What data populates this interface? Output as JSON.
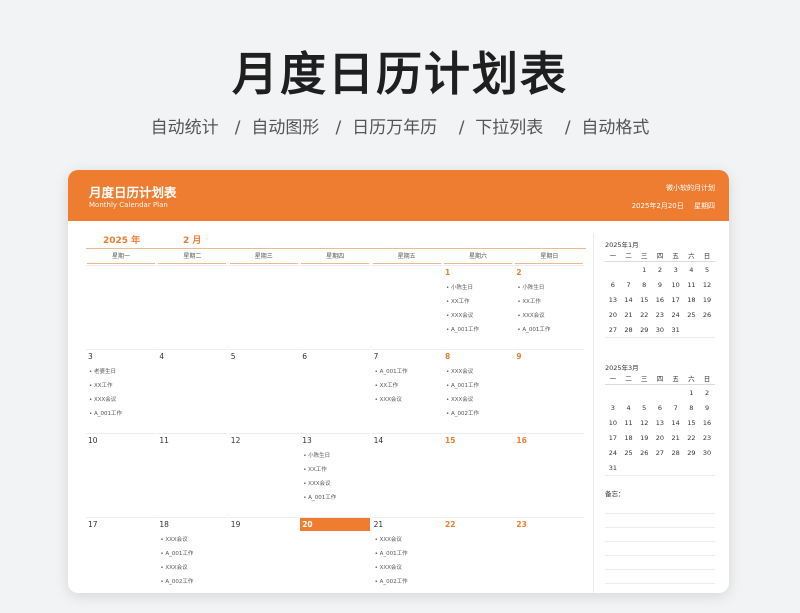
{
  "hero": {
    "title": "月度日历计划表",
    "subtitle": "自动统计   /  自动图形   /  日历万年历    /  下拉列表    /  自动格式"
  },
  "header": {
    "title": "月度日历计划表",
    "subtitle_en": "Monthly Calendar Plan",
    "author": "微小软的月计划",
    "date": "2025年2月20日",
    "weekday": "星期四"
  },
  "calendar": {
    "year_label": "2025 年",
    "month_label": "2 月",
    "weekdays": [
      "星期一",
      "星期二",
      "星期三",
      "星期四",
      "星期五",
      "星期六",
      "星期日"
    ],
    "today": "20",
    "weeks": [
      [
        {
          "day": "",
          "events": []
        },
        {
          "day": "",
          "events": []
        },
        {
          "day": "",
          "events": []
        },
        {
          "day": "",
          "events": []
        },
        {
          "day": "",
          "events": []
        },
        {
          "day": "1",
          "weekend": true,
          "events": [
            "• 小陈生日",
            "• XX工作",
            "• XXX会议",
            "• A_001工作"
          ]
        },
        {
          "day": "2",
          "weekend": true,
          "events": [
            "• 小陈生日",
            "• XX工作",
            "• XXX会议",
            "• A_001工作"
          ]
        }
      ],
      [
        {
          "day": "3",
          "events": [
            "• 老婆生日",
            "• XX工作",
            "• XXX会议",
            "• A_001工作"
          ]
        },
        {
          "day": "4",
          "events": []
        },
        {
          "day": "5",
          "events": []
        },
        {
          "day": "6",
          "events": []
        },
        {
          "day": "7",
          "events": [
            "• A_001工作",
            "• XX工作",
            "• XXX会议"
          ]
        },
        {
          "day": "8",
          "weekend": true,
          "events": [
            "• XXX会议",
            "• A_001工作",
            "• XXX会议",
            "• A_002工作"
          ]
        },
        {
          "day": "9",
          "weekend": true,
          "events": []
        }
      ],
      [
        {
          "day": "10",
          "events": []
        },
        {
          "day": "11",
          "events": []
        },
        {
          "day": "12",
          "events": []
        },
        {
          "day": "13",
          "events": [
            "• 小陈生日",
            "• XX工作",
            "• XXX会议",
            "• A_001工作"
          ]
        },
        {
          "day": "14",
          "events": []
        },
        {
          "day": "15",
          "weekend": true,
          "events": []
        },
        {
          "day": "16",
          "weekend": true,
          "events": []
        }
      ],
      [
        {
          "day": "17",
          "events": []
        },
        {
          "day": "18",
          "events": [
            "• XXX会议",
            "• A_001工作",
            "• XXX会议",
            "• A_002工作"
          ]
        },
        {
          "day": "19",
          "events": []
        },
        {
          "day": "20",
          "today": true,
          "events": []
        },
        {
          "day": "21",
          "events": [
            "• XXX会议",
            "• A_001工作",
            "• XXX会议",
            "• A_002工作"
          ]
        },
        {
          "day": "22",
          "weekend": true,
          "events": []
        },
        {
          "day": "23",
          "weekend": true,
          "events": []
        }
      ]
    ]
  },
  "mini_calendars": [
    {
      "title": "2025年1月",
      "weekdays": [
        "一",
        "二",
        "三",
        "四",
        "五",
        "六",
        "日"
      ],
      "rows": [
        [
          "",
          "",
          "1",
          "2",
          "3",
          "4",
          "5"
        ],
        [
          "6",
          "7",
          "8",
          "9",
          "10",
          "11",
          "12"
        ],
        [
          "13",
          "14",
          "15",
          "16",
          "17",
          "18",
          "19"
        ],
        [
          "20",
          "21",
          "22",
          "23",
          "24",
          "25",
          "26"
        ],
        [
          "27",
          "28",
          "29",
          "30",
          "31",
          "",
          ""
        ]
      ]
    },
    {
      "title": "2025年3月",
      "weekdays": [
        "一",
        "二",
        "三",
        "四",
        "五",
        "六",
        "日"
      ],
      "rows": [
        [
          "",
          "",
          "",
          "",
          "",
          "1",
          "2"
        ],
        [
          "3",
          "4",
          "5",
          "6",
          "7",
          "8",
          "9"
        ],
        [
          "10",
          "11",
          "12",
          "13",
          "14",
          "15",
          "16"
        ],
        [
          "17",
          "18",
          "19",
          "20",
          "21",
          "22",
          "23"
        ],
        [
          "24",
          "25",
          "26",
          "27",
          "28",
          "29",
          "30"
        ],
        [
          "31",
          "",
          "",
          "",
          "",
          "",
          ""
        ]
      ]
    }
  ],
  "notes": {
    "title": "备忘："
  }
}
